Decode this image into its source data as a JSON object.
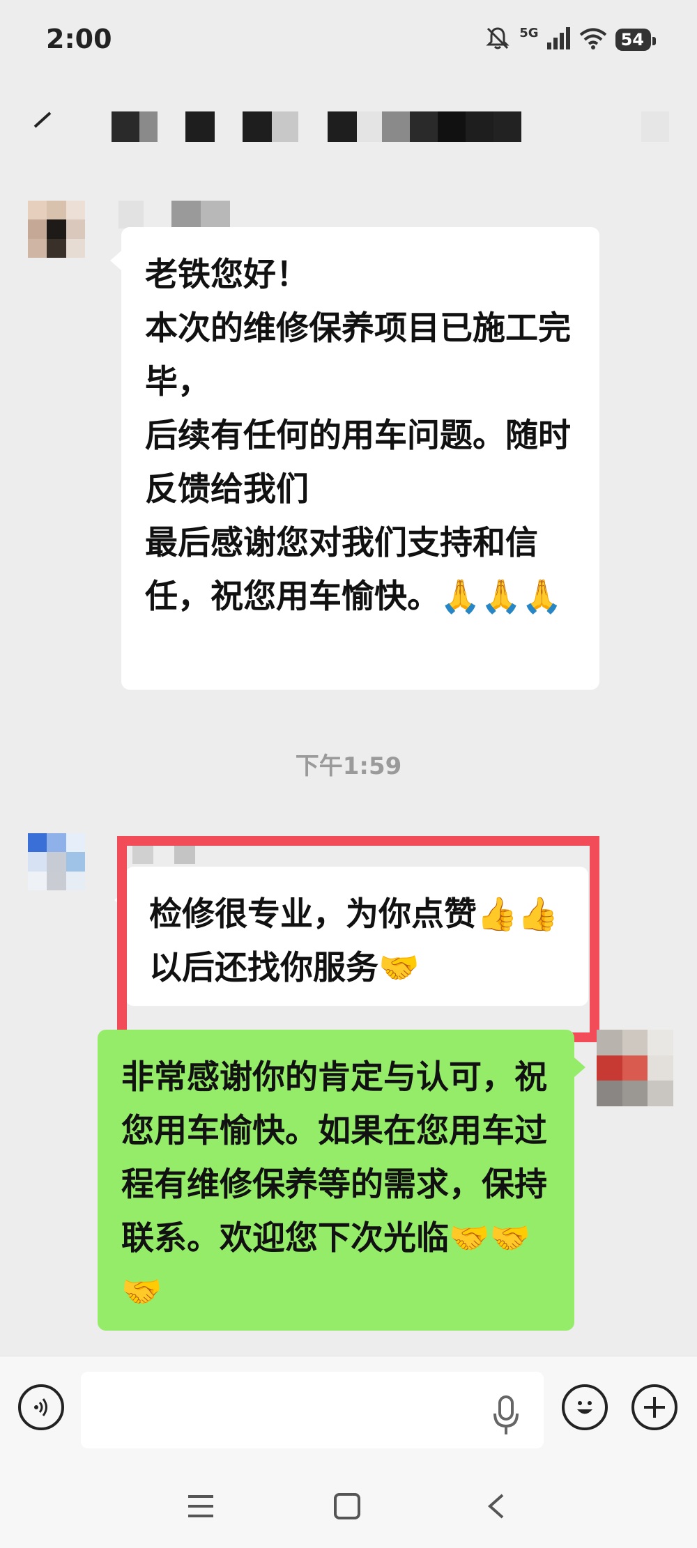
{
  "status_bar": {
    "time": "2:00",
    "network": "5G",
    "battery": "54"
  },
  "header": {
    "back_icon": "back-arrow-icon",
    "title_redacted": true
  },
  "messages": [
    {
      "direction": "incoming",
      "sender_redacted": true,
      "text": "老铁您好！\n本次的维修保养项目已施工完毕，\n后续有任何的用车问题。随时反馈给我们\n最后感谢您对我们支持和信任，祝您用车愉快。🙏🙏🙏"
    },
    {
      "type": "timestamp",
      "text": "下午1:59"
    },
    {
      "direction": "incoming",
      "sender_redacted": true,
      "highlighted": true,
      "text": "检修很专业，为你点赞👍👍以后还找你服务🤝"
    },
    {
      "direction": "outgoing",
      "text": "非常感谢你的肯定与认可，祝您用车愉快。如果在您用车过程有维修保养等的需求，保持联系。欢迎您下次光临🤝🤝🤝"
    }
  ],
  "input_bar": {
    "voice_icon": "voice-mode-icon",
    "mic_icon": "microphone-icon",
    "emoji_icon": "emoji-icon",
    "plus_icon": "plus-icon",
    "value": "",
    "placeholder": ""
  },
  "nav_bar": {
    "icons": [
      "menu-icon",
      "home-icon",
      "back-icon"
    ]
  },
  "colors": {
    "background": "#ededed",
    "incoming_bubble": "#ffffff",
    "outgoing_bubble": "#95ec69",
    "highlight": "#f24c58"
  }
}
